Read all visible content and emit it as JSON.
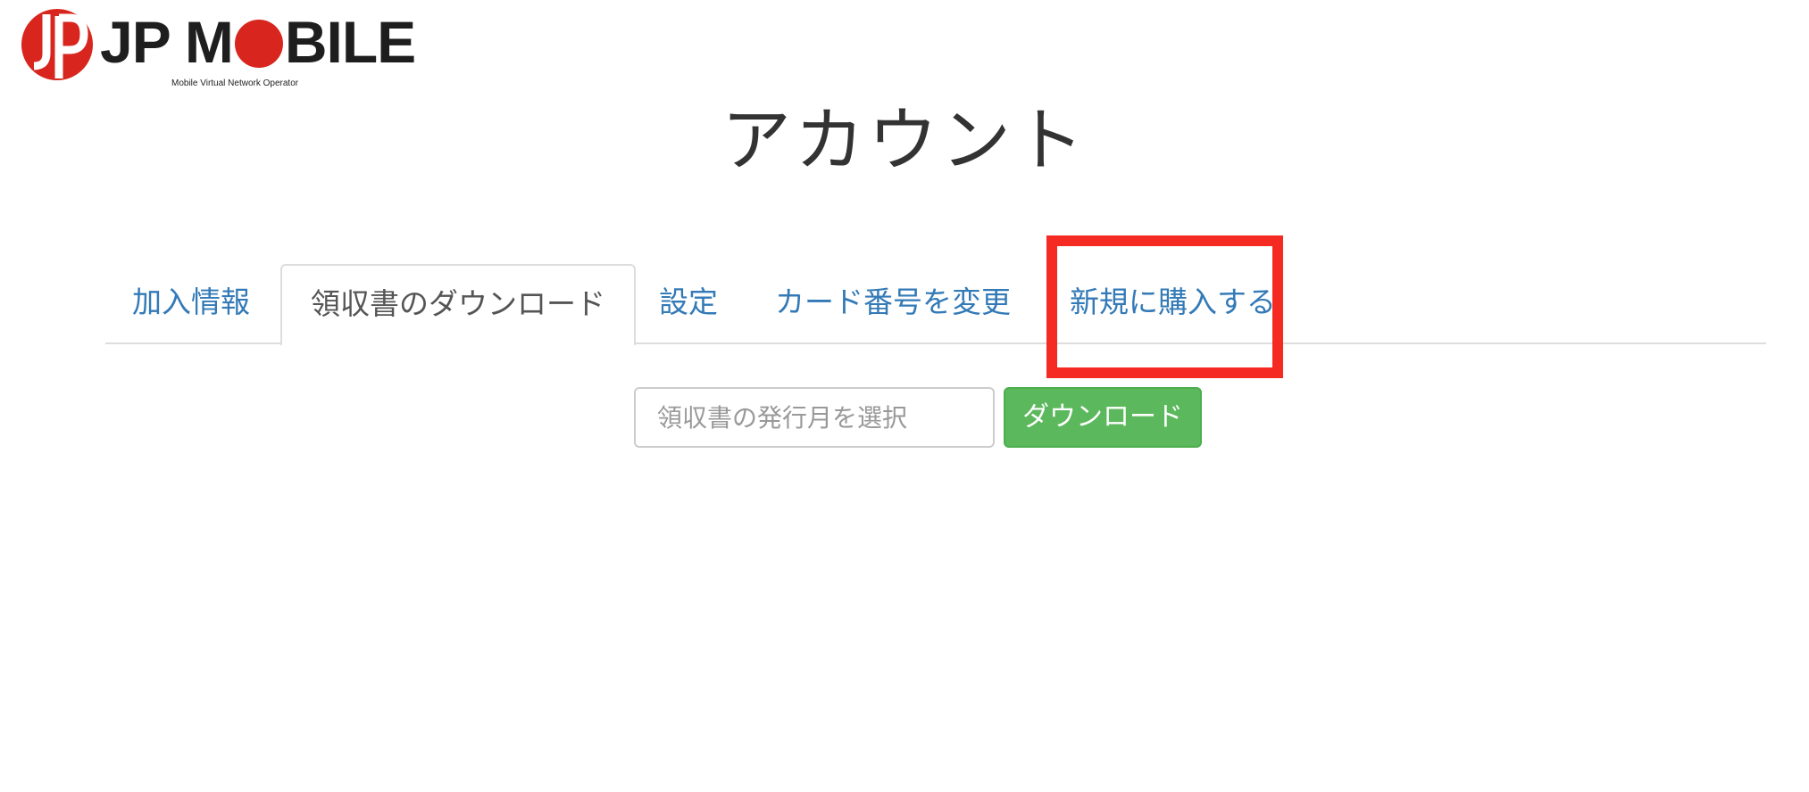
{
  "brand": {
    "name_prefix": "JP M",
    "name_suffix": "BILE",
    "tagline": "Mobile Virtual Network Operator",
    "accent_color": "#d8251d"
  },
  "page": {
    "title": "アカウント"
  },
  "tabs": [
    {
      "label": "加入情報",
      "active": false
    },
    {
      "label": "領収書のダウンロード",
      "active": true
    },
    {
      "label": "設定",
      "active": false
    },
    {
      "label": "カード番号を変更",
      "active": false
    },
    {
      "label": "新規に購入する",
      "active": false,
      "highlighted": true
    }
  ],
  "download": {
    "month_placeholder": "領収書の発行月を選択",
    "month_value": "",
    "button_label": "ダウンロード",
    "button_color": "#5cb85c"
  },
  "colors": {
    "link": "#337ab7",
    "highlight": "#f52a22"
  }
}
